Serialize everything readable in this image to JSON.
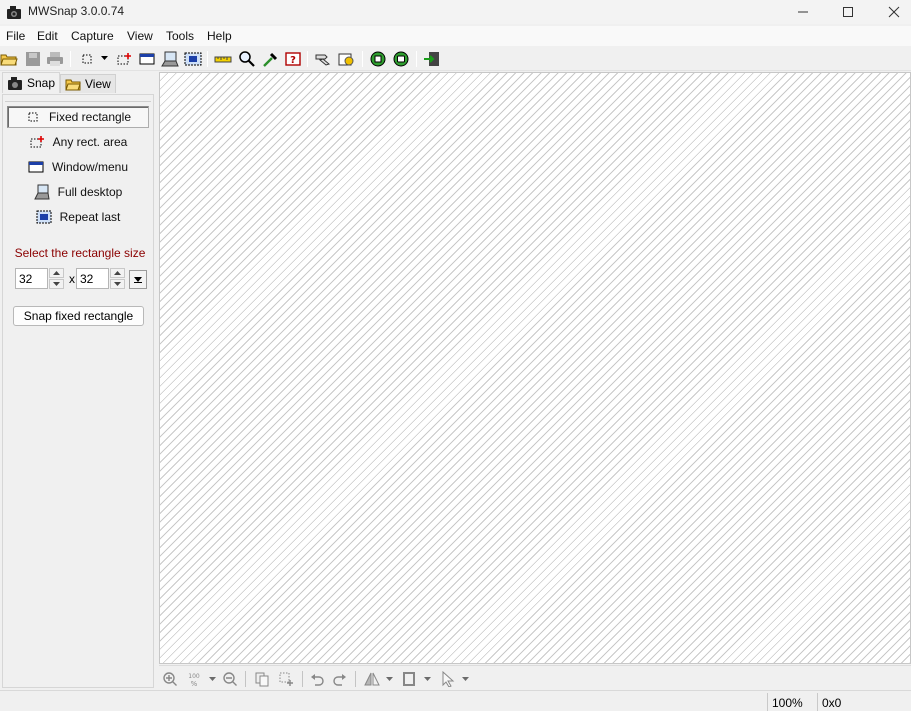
{
  "window": {
    "title": "MWSnap 3.0.0.74",
    "icons": {
      "app": "camera-icon",
      "minimize": "minimize-icon",
      "maximize": "maximize-icon",
      "close": "close-icon"
    }
  },
  "menu": {
    "items": [
      "File",
      "Edit",
      "Capture",
      "View",
      "Tools",
      "Help"
    ]
  },
  "toolbar": {
    "icons": [
      "open-folder-icon",
      "save-icon",
      "print-icon",
      "fixed-rect-icon",
      "any-rect-icon",
      "window-icon",
      "desktop-icon",
      "repeat-last-icon",
      "ruler-icon",
      "zoom-icon",
      "color-picker-icon",
      "help-icon",
      "settings-icon",
      "hotkeys-icon",
      "green-record-icon",
      "green-print-icon",
      "exit-icon"
    ]
  },
  "tabs": [
    {
      "label": "Snap",
      "icon": "camera-icon"
    },
    {
      "label": "View",
      "icon": "open-folder-icon"
    }
  ],
  "capture_modes": [
    {
      "label": "Fixed rectangle",
      "icon": "fixed-rect-icon",
      "active": true
    },
    {
      "label": "Any rect. area",
      "icon": "any-rect-icon",
      "active": false
    },
    {
      "label": "Window/menu",
      "icon": "window-icon",
      "active": false
    },
    {
      "label": "Full desktop",
      "icon": "desktop-icon",
      "active": false
    },
    {
      "label": "Repeat last",
      "icon": "repeat-last-icon",
      "active": false
    }
  ],
  "size_panel": {
    "label": "Select the rectangle size",
    "width": "32",
    "height": "32",
    "separator": "x",
    "snap_button": "Snap fixed rectangle"
  },
  "bottom_toolbar": {
    "icons": [
      "zoom-in-icon",
      "zoom-percent-icon",
      "zoom-out-icon",
      "copy-icon",
      "crop-icon",
      "undo-icon",
      "redo-icon",
      "flip-icon",
      "frame-icon",
      "cursor-icon"
    ]
  },
  "status": {
    "zoom": "100%",
    "size": "0x0"
  },
  "colors": {
    "size_label": "#8b0000",
    "chrome": "#f0f0f0"
  }
}
